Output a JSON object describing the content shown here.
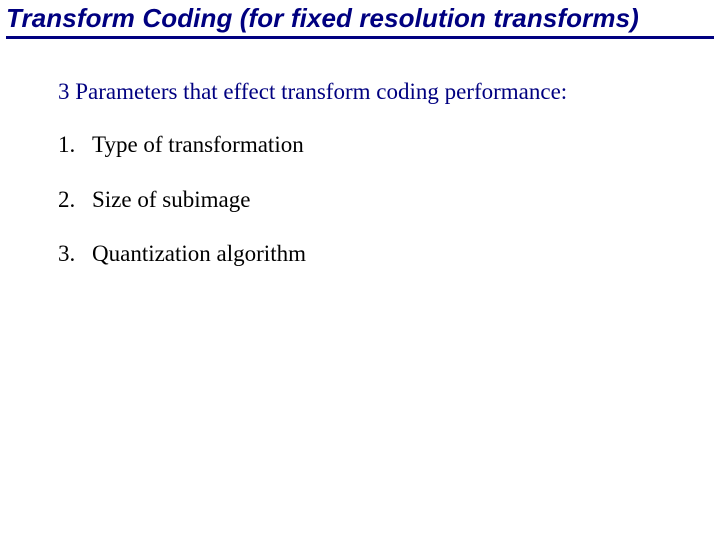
{
  "title": "Transform Coding (for fixed resolution transforms)",
  "intro": "3 Parameters that effect transform coding performance:",
  "items": [
    {
      "num": "1.",
      "text": "Type of transformation"
    },
    {
      "num": "2.",
      "text": "Size of subimage"
    },
    {
      "num": "3.",
      "text": "Quantization algorithm"
    }
  ]
}
